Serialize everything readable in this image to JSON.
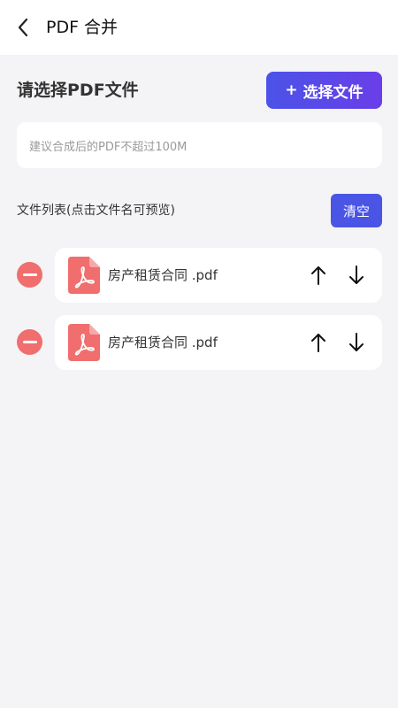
{
  "header": {
    "title": "PDF 合并",
    "back_icon": "chevron-left-icon"
  },
  "main": {
    "heading": "请选择PDF文件",
    "select_button": {
      "plus": "+",
      "label": "选择文件"
    },
    "hint": "建议合成后的PDF不超过100M",
    "list_label": "文件列表(点击文件名可预览)",
    "clear_label": "清空",
    "files": [
      {
        "name": "房产租赁合同 .pdf"
      },
      {
        "name": "房产租赁合同 .pdf"
      }
    ]
  },
  "colors": {
    "accent": "#4a55e6",
    "accent_gradient_end": "#6a3ee8",
    "remove": "#f06e6e",
    "pdf_icon": "#f06e6e",
    "background": "#f4f4f6"
  }
}
